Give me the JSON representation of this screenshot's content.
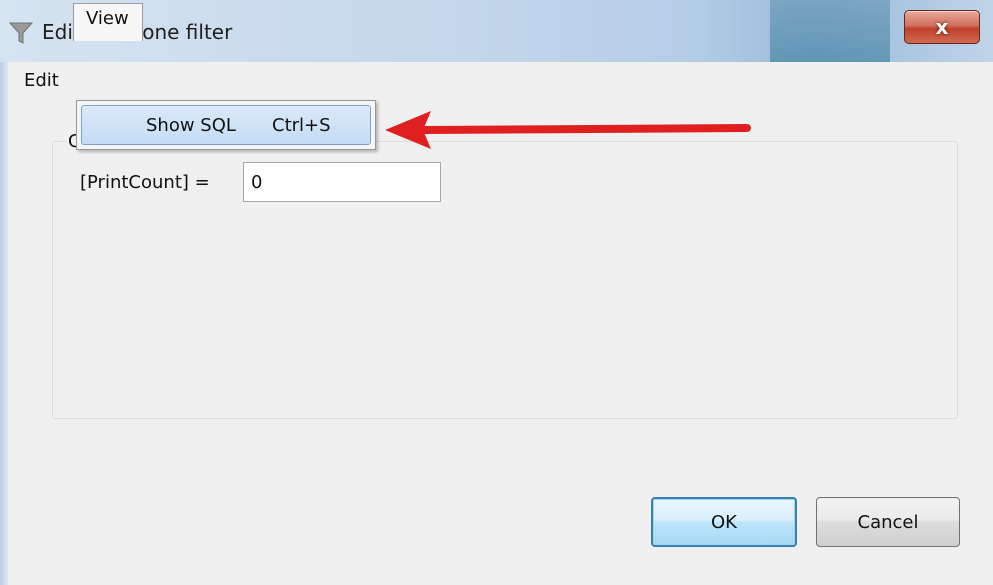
{
  "window": {
    "title": "Edit level-one filter",
    "close_glyph": "x"
  },
  "menubar": {
    "items": [
      {
        "label": "Edit"
      },
      {
        "label": "View"
      }
    ]
  },
  "dropdown": {
    "items": [
      {
        "label": "Show SQL",
        "shortcut": "Ctrl+S"
      }
    ]
  },
  "group": {
    "caption_visible_char": "C"
  },
  "field": {
    "label": "[PrintCount] =",
    "value": "0"
  },
  "buttons": {
    "ok_label": "OK",
    "cancel_label": "Cancel"
  },
  "icons": {
    "title_icon": "filter-funnel-icon",
    "annotation": "red-arrow-icon"
  },
  "colors": {
    "arrow_red": "#e02020",
    "selection_blue": "#c4dcf5",
    "close_red": "#c0412b"
  }
}
